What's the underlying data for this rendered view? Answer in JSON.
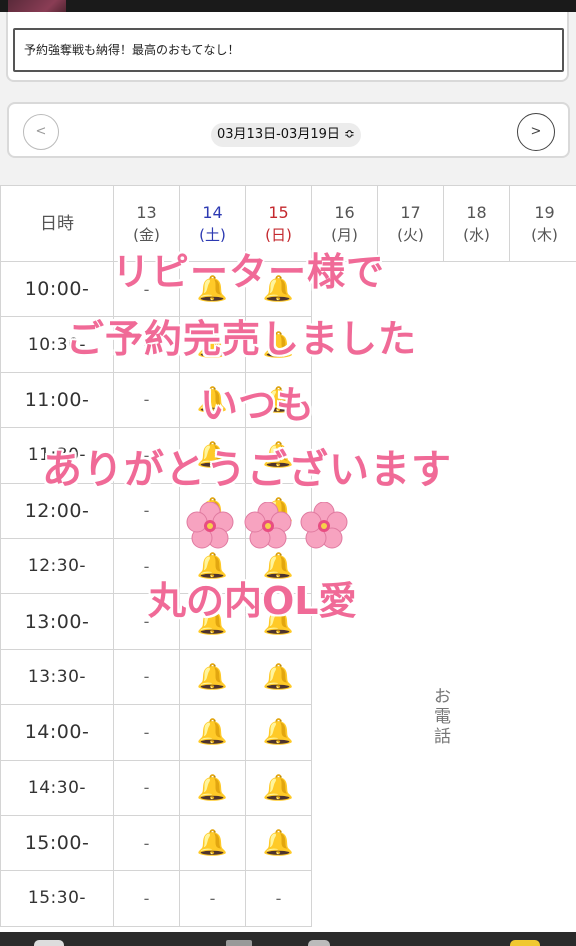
{
  "message": {
    "text": "予約強奪戦も納得！最高のおもてなし！"
  },
  "date_nav": {
    "prev_icon": "<",
    "next_icon": ">",
    "range_label": "03月13日-03月19日 ≎"
  },
  "schedule": {
    "corner_label": "日時",
    "days": [
      {
        "num": "13",
        "wd": "(金)",
        "type": "weekday"
      },
      {
        "num": "14",
        "wd": "(土)",
        "type": "sat"
      },
      {
        "num": "15",
        "wd": "(日)",
        "type": "sun"
      },
      {
        "num": "16",
        "wd": "(月)",
        "type": "weekday"
      },
      {
        "num": "17",
        "wd": "(火)",
        "type": "weekday"
      },
      {
        "num": "18",
        "wd": "(水)",
        "type": "weekday"
      },
      {
        "num": "19",
        "wd": "(木)",
        "type": "weekday"
      }
    ],
    "rows": [
      {
        "time": "10:00-",
        "cells": [
          "-",
          "bell",
          "bell"
        ]
      },
      {
        "time": "10:30-",
        "cells": [
          "-",
          "bell",
          "bell"
        ]
      },
      {
        "time": "11:00-",
        "cells": [
          "-",
          "bell",
          "bell"
        ]
      },
      {
        "time": "11:30-",
        "cells": [
          "-",
          "bell",
          "bell"
        ]
      },
      {
        "time": "12:00-",
        "cells": [
          "-",
          "bell",
          "bell"
        ]
      },
      {
        "time": "12:30-",
        "cells": [
          "-",
          "bell",
          "bell"
        ]
      },
      {
        "time": "13:00-",
        "cells": [
          "-",
          "bell",
          "bell"
        ]
      },
      {
        "time": "13:30-",
        "cells": [
          "-",
          "bell",
          "bell"
        ]
      },
      {
        "time": "14:00-",
        "cells": [
          "-",
          "bell",
          "bell"
        ]
      },
      {
        "time": "14:30-",
        "cells": [
          "-",
          "bell",
          "bell"
        ]
      },
      {
        "time": "15:00-",
        "cells": [
          "-",
          "bell",
          "bell"
        ]
      },
      {
        "time": "15:30-",
        "cells": [
          "-",
          "-",
          "-"
        ]
      }
    ],
    "phone_note": "お電話"
  },
  "overlay": {
    "line1": "リピーター様で",
    "line2": "ご予約完売しました",
    "line3": "いつも",
    "line4": "ありがとうございます",
    "line6": "丸の内OL愛",
    "blossom_icon": "cherry-blossom-icon"
  },
  "colors": {
    "accent_pink": "#f06a97",
    "sat_blue": "#2d3ab2",
    "sun_red": "#c4282e",
    "bell_yellow": "#f4b400"
  }
}
